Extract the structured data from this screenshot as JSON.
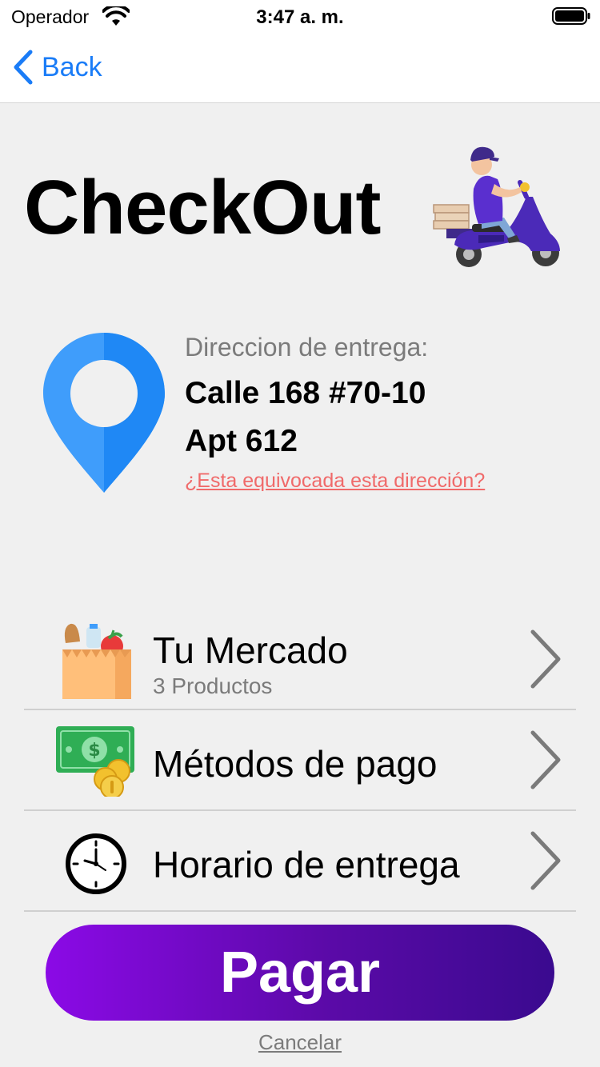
{
  "status_bar": {
    "carrier": "Operador",
    "time": "3:47 a. m."
  },
  "nav": {
    "back_label": "Back"
  },
  "page": {
    "title": "CheckOut"
  },
  "address": {
    "label": "Direccion de entrega:",
    "line1": "Calle 168 #70-10",
    "line2": "Apt 612",
    "wrong_link": "¿Esta equivocada esta dirección?"
  },
  "menu": {
    "items": [
      {
        "title": "Tu Mercado",
        "subtitle": "3 Productos",
        "icon": "grocery-bag-icon"
      },
      {
        "title": "Métodos de pago",
        "icon": "money-coins-icon"
      },
      {
        "title": "Horario de entrega",
        "icon": "clock-icon"
      }
    ]
  },
  "actions": {
    "pay_label": "Pagar",
    "cancel_label": "Cancelar"
  },
  "colors": {
    "accent_blue": "#1a7cf7",
    "link_red": "#f06a6a",
    "pay_gradient_start": "#8b0ae6",
    "pay_gradient_end": "#3a0a8f",
    "background": "#f0f0f0"
  }
}
